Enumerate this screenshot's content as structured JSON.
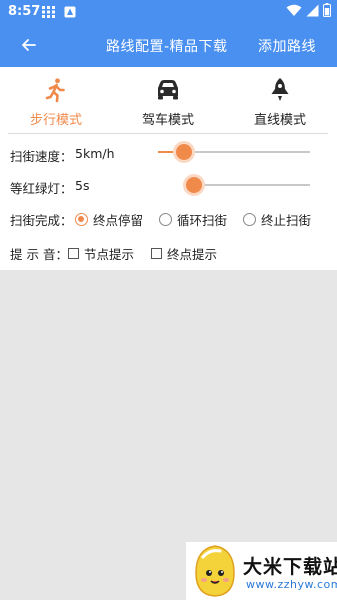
{
  "status_bar": {
    "time": "8:57",
    "icons_left": [
      "grid-app-icon",
      "square-app-icon"
    ],
    "icons_right": [
      "wifi-icon",
      "signal-icon",
      "battery-icon"
    ]
  },
  "app_bar": {
    "back_icon": "arrow-left-icon",
    "title": "路线配置-精品下载",
    "action": "添加路线"
  },
  "modes": [
    {
      "label": "步行模式",
      "icon": "walking-person-icon",
      "active": true
    },
    {
      "label": "驾车模式",
      "icon": "car-icon",
      "active": false
    },
    {
      "label": "直线模式",
      "icon": "rocket-icon",
      "active": false
    }
  ],
  "settings": {
    "speed": {
      "label": "扫街速度：",
      "value_text": "5km/h",
      "level": 0.17
    },
    "light": {
      "label": "等红绿灯：",
      "value_text": "5s",
      "level": 0.08
    },
    "finish": {
      "label": "扫街完成：",
      "options": [
        {
          "label": "终点停留",
          "checked": true
        },
        {
          "label": "循环扫街",
          "checked": false
        },
        {
          "label": "终止扫街",
          "checked": false
        }
      ]
    },
    "sound": {
      "label": "提 示 音：",
      "options": [
        {
          "label": "节点提示",
          "checked": false
        },
        {
          "label": "终点提示",
          "checked": false
        }
      ]
    }
  },
  "colors": {
    "primary": "#4a90f0",
    "accent": "#f08a4b",
    "background": "#e6e6e6"
  },
  "watermark": {
    "brand": "大米下载站",
    "url": "www.zzhyw.com"
  }
}
